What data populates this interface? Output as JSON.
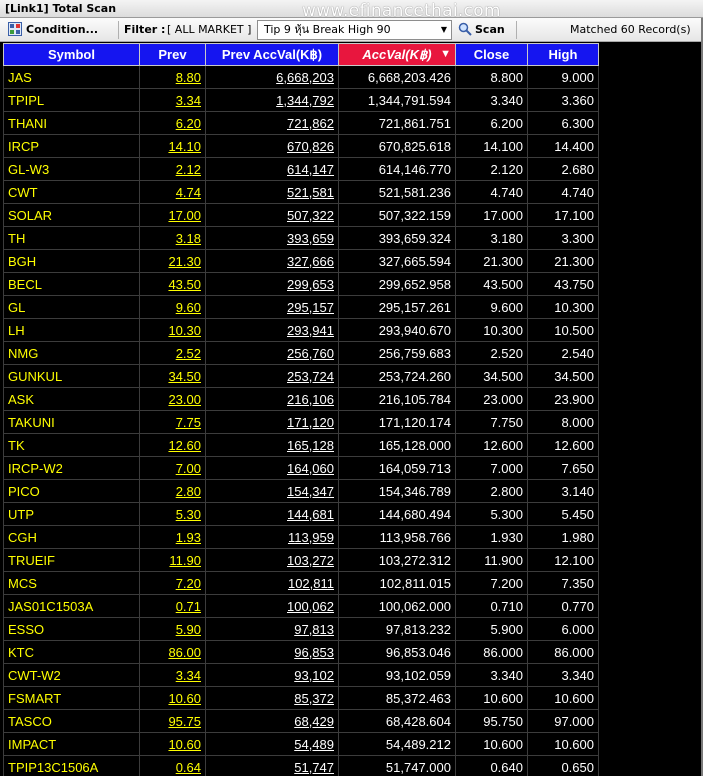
{
  "window": {
    "title": "[Link1] Total Scan"
  },
  "watermark": "www.efinancethai.com",
  "toolbar": {
    "condition_label": "Condition...",
    "filter_label": "Filter :",
    "filter_value": "[ ALL MARKET ]",
    "tip_selected": "Tip 9 หุ้น  Break High 90",
    "scan_label": "Scan",
    "matched_text": "Matched 60 Record(s)"
  },
  "columns": {
    "symbol": "Symbol",
    "prev": "Prev",
    "prev_accval": "Prev AccVal(K฿)",
    "accval": "AccVal(K฿)",
    "close": "Close",
    "high": "High"
  },
  "colors": {
    "header_blue": "#1515f0",
    "header_sorted_red": "#e8163e",
    "symbol_yellow": "#ffff00",
    "value_white": "#ffffff",
    "background": "#000000"
  },
  "rows": [
    {
      "symbol": "JAS",
      "prev": "8.80",
      "prev_accval": "6,668,203",
      "accval": "6,668,203.426",
      "close": "8.800",
      "high": "9.000"
    },
    {
      "symbol": "TPIPL",
      "prev": "3.34",
      "prev_accval": "1,344,792",
      "accval": "1,344,791.594",
      "close": "3.340",
      "high": "3.360"
    },
    {
      "symbol": "THANI",
      "prev": "6.20",
      "prev_accval": "721,862",
      "accval": "721,861.751",
      "close": "6.200",
      "high": "6.300"
    },
    {
      "symbol": "IRCP",
      "prev": "14.10",
      "prev_accval": "670,826",
      "accval": "670,825.618",
      "close": "14.100",
      "high": "14.400"
    },
    {
      "symbol": "GL-W3",
      "prev": "2.12",
      "prev_accval": "614,147",
      "accval": "614,146.770",
      "close": "2.120",
      "high": "2.680"
    },
    {
      "symbol": "CWT",
      "prev": "4.74",
      "prev_accval": "521,581",
      "accval": "521,581.236",
      "close": "4.740",
      "high": "4.740"
    },
    {
      "symbol": "SOLAR",
      "prev": "17.00",
      "prev_accval": "507,322",
      "accval": "507,322.159",
      "close": "17.000",
      "high": "17.100"
    },
    {
      "symbol": "TH",
      "prev": "3.18",
      "prev_accval": "393,659",
      "accval": "393,659.324",
      "close": "3.180",
      "high": "3.300"
    },
    {
      "symbol": "BGH",
      "prev": "21.30",
      "prev_accval": "327,666",
      "accval": "327,665.594",
      "close": "21.300",
      "high": "21.300"
    },
    {
      "symbol": "BECL",
      "prev": "43.50",
      "prev_accval": "299,653",
      "accval": "299,652.958",
      "close": "43.500",
      "high": "43.750"
    },
    {
      "symbol": "GL",
      "prev": "9.60",
      "prev_accval": "295,157",
      "accval": "295,157.261",
      "close": "9.600",
      "high": "10.300"
    },
    {
      "symbol": "LH",
      "prev": "10.30",
      "prev_accval": "293,941",
      "accval": "293,940.670",
      "close": "10.300",
      "high": "10.500"
    },
    {
      "symbol": "NMG",
      "prev": "2.52",
      "prev_accval": "256,760",
      "accval": "256,759.683",
      "close": "2.520",
      "high": "2.540"
    },
    {
      "symbol": "GUNKUL",
      "prev": "34.50",
      "prev_accval": "253,724",
      "accval": "253,724.260",
      "close": "34.500",
      "high": "34.500"
    },
    {
      "symbol": "ASK",
      "prev": "23.00",
      "prev_accval": "216,106",
      "accval": "216,105.784",
      "close": "23.000",
      "high": "23.900"
    },
    {
      "symbol": "TAKUNI",
      "prev": "7.75",
      "prev_accval": "171,120",
      "accval": "171,120.174",
      "close": "7.750",
      "high": "8.000"
    },
    {
      "symbol": "TK",
      "prev": "12.60",
      "prev_accval": "165,128",
      "accval": "165,128.000",
      "close": "12.600",
      "high": "12.600"
    },
    {
      "symbol": "IRCP-W2",
      "prev": "7.00",
      "prev_accval": "164,060",
      "accval": "164,059.713",
      "close": "7.000",
      "high": "7.650"
    },
    {
      "symbol": "PICO",
      "prev": "2.80",
      "prev_accval": "154,347",
      "accval": "154,346.789",
      "close": "2.800",
      "high": "3.140"
    },
    {
      "symbol": "UTP",
      "prev": "5.30",
      "prev_accval": "144,681",
      "accval": "144,680.494",
      "close": "5.300",
      "high": "5.450"
    },
    {
      "symbol": "CGH",
      "prev": "1.93",
      "prev_accval": "113,959",
      "accval": "113,958.766",
      "close": "1.930",
      "high": "1.980"
    },
    {
      "symbol": "TRUEIF",
      "prev": "11.90",
      "prev_accval": "103,272",
      "accval": "103,272.312",
      "close": "11.900",
      "high": "12.100"
    },
    {
      "symbol": "MCS",
      "prev": "7.20",
      "prev_accval": "102,811",
      "accval": "102,811.015",
      "close": "7.200",
      "high": "7.350"
    },
    {
      "symbol": "JAS01C1503A",
      "prev": "0.71",
      "prev_accval": "100,062",
      "accval": "100,062.000",
      "close": "0.710",
      "high": "0.770"
    },
    {
      "symbol": "ESSO",
      "prev": "5.90",
      "prev_accval": "97,813",
      "accval": "97,813.232",
      "close": "5.900",
      "high": "6.000"
    },
    {
      "symbol": "KTC",
      "prev": "86.00",
      "prev_accval": "96,853",
      "accval": "96,853.046",
      "close": "86.000",
      "high": "86.000"
    },
    {
      "symbol": "CWT-W2",
      "prev": "3.34",
      "prev_accval": "93,102",
      "accval": "93,102.059",
      "close": "3.340",
      "high": "3.340"
    },
    {
      "symbol": "FSMART",
      "prev": "10.60",
      "prev_accval": "85,372",
      "accval": "85,372.463",
      "close": "10.600",
      "high": "10.600"
    },
    {
      "symbol": "TASCO",
      "prev": "95.75",
      "prev_accval": "68,429",
      "accval": "68,428.604",
      "close": "95.750",
      "high": "97.000"
    },
    {
      "symbol": "IMPACT",
      "prev": "10.60",
      "prev_accval": "54,489",
      "accval": "54,489.212",
      "close": "10.600",
      "high": "10.600"
    },
    {
      "symbol": "TPIP13C1506A",
      "prev": "0.64",
      "prev_accval": "51,747",
      "accval": "51,747.000",
      "close": "0.640",
      "high": "0.650"
    }
  ]
}
